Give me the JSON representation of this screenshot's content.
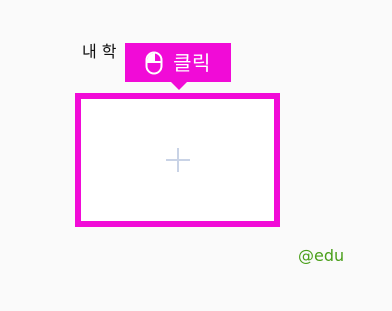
{
  "section": {
    "label": "내 학"
  },
  "tooltip": {
    "icon": "mouse-icon",
    "text": "클릭"
  },
  "add_box": {
    "icon": "plus-icon"
  },
  "watermark": {
    "text": "@edu"
  },
  "colors": {
    "highlight": "#f10bd7",
    "plus": "#c9d3e6",
    "watermark": "#4a9f1a",
    "background": "#fafafa"
  }
}
